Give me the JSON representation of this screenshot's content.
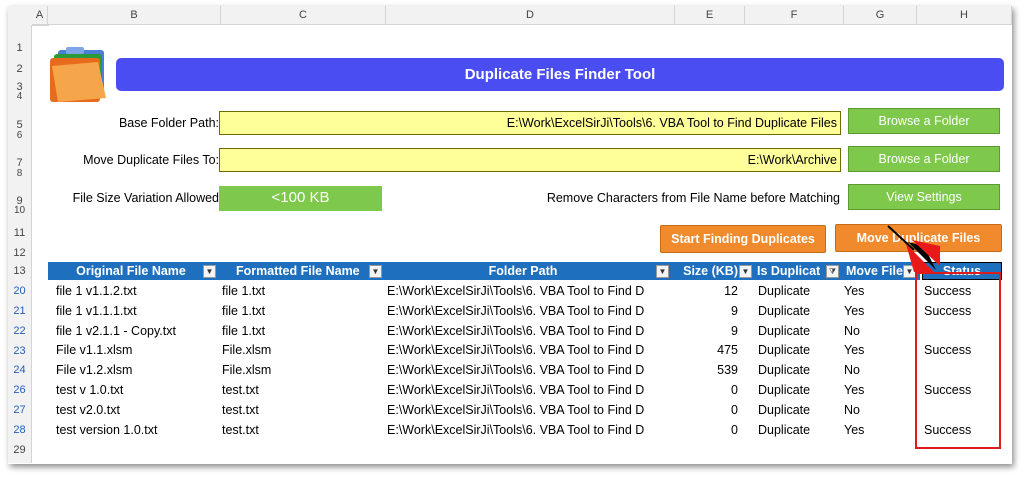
{
  "columns": [
    "A",
    "B",
    "C",
    "D",
    "E",
    "F",
    "G",
    "H"
  ],
  "banner_title": "Duplicate Files Finder Tool",
  "form": {
    "base_folder_label": "Base Folder Path:",
    "base_folder_value": "E:\\Work\\ExcelSirJi\\Tools\\6. VBA Tool to Find Duplicate Files",
    "move_label": "Move Duplicate Files To:",
    "move_value": "E:\\Work\\Archive",
    "size_label": "File Size Variation Allowed",
    "size_value": "<100 KB",
    "remove_label": "Remove Characters from File Name before Matching"
  },
  "buttons": {
    "browse1": "Browse a Folder",
    "browse2": "Browse a Folder",
    "view_settings": "View Settings",
    "start": "Start Finding Duplicates",
    "move": "Move Duplicate Files"
  },
  "table": {
    "headers": [
      "Original File Name",
      "Formatted File Name",
      "Folder Path",
      "Size (KB)",
      "Is Duplicat",
      "Move File",
      "Status"
    ],
    "rows": [
      {
        "row": "20",
        "orig": "file 1 v1.1.2.txt",
        "fmt": "file 1.txt",
        "path": "E:\\Work\\ExcelSirJi\\Tools\\6. VBA Tool to Find D",
        "size": "12",
        "dup": "Duplicate",
        "move": "Yes",
        "status": "Success"
      },
      {
        "row": "21",
        "orig": "file 1 v1.1.1.txt",
        "fmt": "file 1.txt",
        "path": "E:\\Work\\ExcelSirJi\\Tools\\6. VBA Tool to Find D",
        "size": "9",
        "dup": "Duplicate",
        "move": "Yes",
        "status": "Success"
      },
      {
        "row": "22",
        "orig": "file 1 v2.1.1 - Copy.txt",
        "fmt": "file 1.txt",
        "path": "E:\\Work\\ExcelSirJi\\Tools\\6. VBA Tool to Find D",
        "size": "9",
        "dup": "Duplicate",
        "move": "No",
        "status": ""
      },
      {
        "row": "23",
        "orig": "File v1.1.xlsm",
        "fmt": "File.xlsm",
        "path": "E:\\Work\\ExcelSirJi\\Tools\\6. VBA Tool to Find D",
        "size": "475",
        "dup": "Duplicate",
        "move": "Yes",
        "status": "Success"
      },
      {
        "row": "24",
        "orig": "File v1.2.xlsm",
        "fmt": "File.xlsm",
        "path": "E:\\Work\\ExcelSirJi\\Tools\\6. VBA Tool to Find D",
        "size": "539",
        "dup": "Duplicate",
        "move": "No",
        "status": ""
      },
      {
        "row": "26",
        "orig": "test v 1.0.txt",
        "fmt": "test.txt",
        "path": "E:\\Work\\ExcelSirJi\\Tools\\6. VBA Tool to Find D",
        "size": "0",
        "dup": "Duplicate",
        "move": "Yes",
        "status": "Success"
      },
      {
        "row": "27",
        "orig": "test v2.0.txt",
        "fmt": "test.txt",
        "path": "E:\\Work\\ExcelSirJi\\Tools\\6. VBA Tool to Find D",
        "size": "0",
        "dup": "Duplicate",
        "move": "No",
        "status": ""
      },
      {
        "row": "28",
        "orig": "test version 1.0.txt",
        "fmt": "test.txt",
        "path": "E:\\Work\\ExcelSirJi\\Tools\\6. VBA Tool to Find D",
        "size": "0",
        "dup": "Duplicate",
        "move": "Yes",
        "status": "Success"
      }
    ]
  },
  "header_rows": [
    "1",
    "2",
    "3",
    "4",
    "5",
    "6",
    "7",
    "8",
    "9",
    "10",
    "11",
    "12",
    "13"
  ],
  "last_row": "29",
  "colors": {
    "banner": "#4a4df2",
    "table_header": "#1f6fbf",
    "input": "#ffff99",
    "green_button": "#7ec84c",
    "orange_button": "#f08a2c",
    "highlight": "#e01b1b"
  }
}
